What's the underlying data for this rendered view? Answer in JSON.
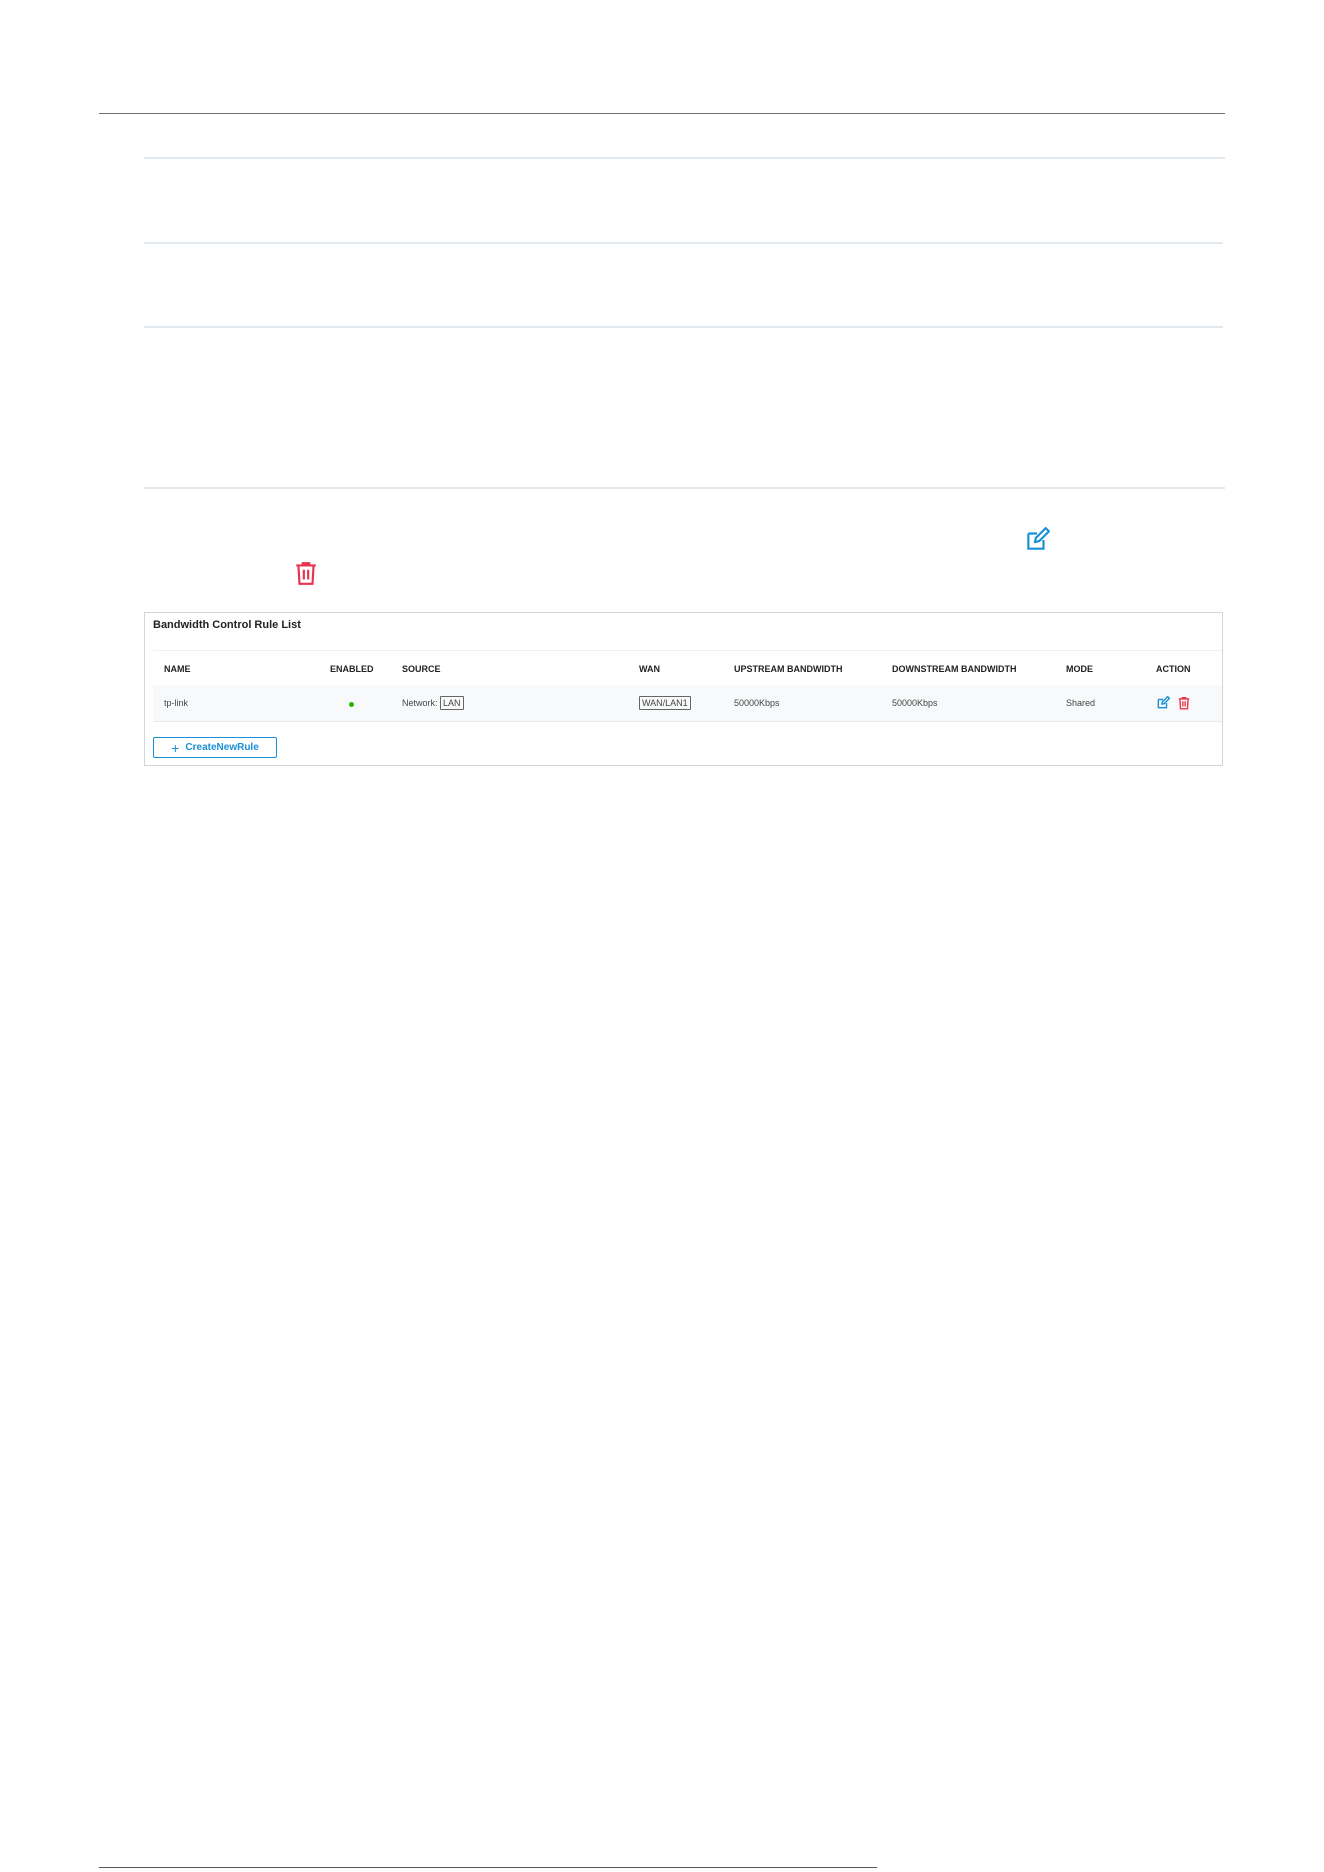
{
  "colors": {
    "accent": "#1890d6",
    "danger": "#e8344e",
    "enabled_dot": "#2db400"
  },
  "icons": {
    "edit": "edit-icon",
    "delete": "trash-icon",
    "add": "plus-icon"
  },
  "panel": {
    "title": "Bandwidth Control Rule List",
    "columns": [
      "NAME",
      "ENABLED",
      "SOURCE",
      "WAN",
      "UPSTREAM BANDWIDTH",
      "DOWNSTREAM BANDWIDTH",
      "MODE",
      "ACTION"
    ],
    "rows": [
      {
        "name": "tp-link",
        "enabled": true,
        "source_prefix": "Network:",
        "source_tag": "LAN",
        "wan": "WAN/LAN1",
        "upstream": "50000Kbps",
        "downstream": "50000Kbps",
        "mode": "Shared"
      }
    ],
    "create_button": "CreateNewRule"
  }
}
